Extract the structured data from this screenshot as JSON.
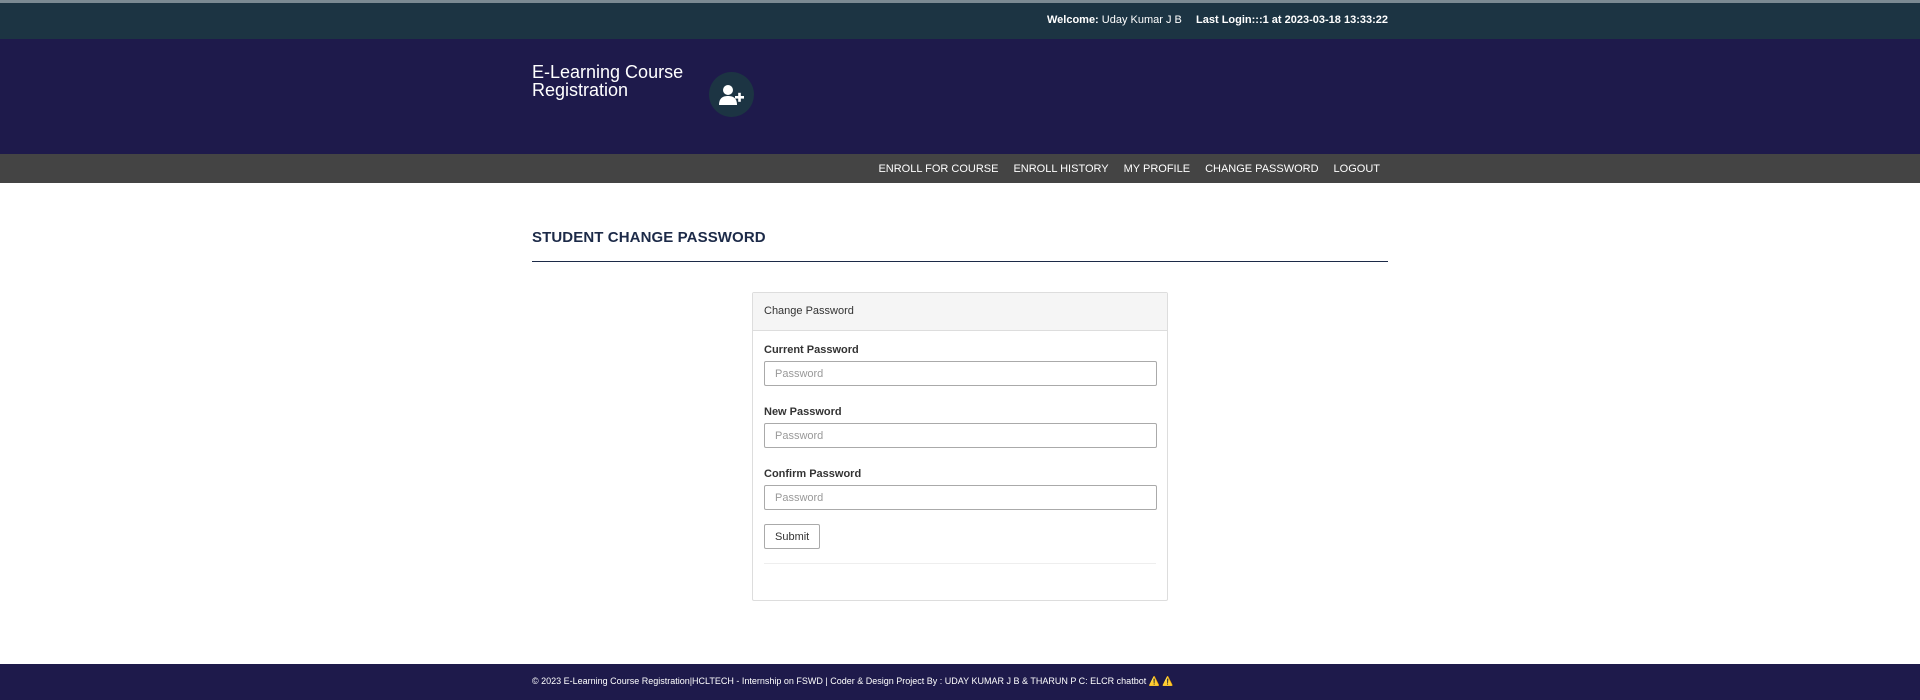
{
  "topbar": {
    "welcome_label": "Welcome:",
    "user_name": "Uday Kumar J B",
    "last_login_label": "Last Login:",
    "last_login_value": "::1 at 2023-03-18 13:33:22"
  },
  "header": {
    "brand": "E-Learning Course Registration",
    "brand_icon": "user-plus-icon"
  },
  "nav": {
    "items": [
      {
        "label": "ENROLL FOR COURSE"
      },
      {
        "label": "ENROLL HISTORY"
      },
      {
        "label": "MY PROFILE"
      },
      {
        "label": "CHANGE PASSWORD"
      },
      {
        "label": "LOGOUT"
      }
    ]
  },
  "main": {
    "page_title": "STUDENT CHANGE PASSWORD",
    "panel": {
      "heading": "Change Password",
      "fields": [
        {
          "label": "Current Password",
          "placeholder": "Password",
          "value": ""
        },
        {
          "label": "New Password",
          "placeholder": "Password",
          "value": ""
        },
        {
          "label": "Confirm Password",
          "placeholder": "Password",
          "value": ""
        }
      ],
      "submit_label": "Submit"
    }
  },
  "footer": {
    "text": "© 2023 E-Learning Course Registration|HCLTECH - Internship on FSWD | Coder & Design Project By : UDAY KUMAR J B & THARUN P C: ELCR chatbot ⚠️ ⚠️"
  },
  "colors": {
    "topbar_bg": "#1c3443",
    "header_bg": "#1e1a4b",
    "nav_bg": "#444444",
    "title_color": "#1c2a48"
  }
}
